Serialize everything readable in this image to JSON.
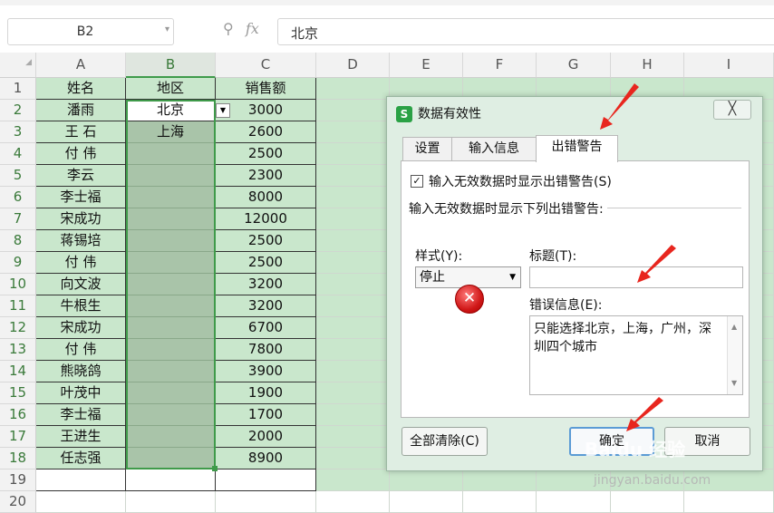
{
  "formula_bar": {
    "name_box": "B2",
    "value": "北京"
  },
  "columns": [
    "A",
    "B",
    "C",
    "D",
    "E",
    "F",
    "G",
    "H",
    "I"
  ],
  "rows": [
    {
      "n": "1",
      "a": "姓名",
      "b": "地区",
      "c": "销售额"
    },
    {
      "n": "2",
      "a": "潘雨",
      "b": "北京",
      "c": "3000"
    },
    {
      "n": "3",
      "a": "王  石",
      "b": "上海",
      "c": "2600"
    },
    {
      "n": "4",
      "a": "付  伟",
      "b": "",
      "c": "2500"
    },
    {
      "n": "5",
      "a": "李云",
      "b": "",
      "c": "2300"
    },
    {
      "n": "6",
      "a": "李士福",
      "b": "",
      "c": "8000"
    },
    {
      "n": "7",
      "a": "宋成功",
      "b": "",
      "c": "12000"
    },
    {
      "n": "8",
      "a": "蒋锡培",
      "b": "",
      "c": "2500"
    },
    {
      "n": "9",
      "a": "付  伟",
      "b": "",
      "c": "2500"
    },
    {
      "n": "10",
      "a": "向文波",
      "b": "",
      "c": "3200"
    },
    {
      "n": "11",
      "a": "牛根生",
      "b": "",
      "c": "3200"
    },
    {
      "n": "12",
      "a": "宋成功",
      "b": "",
      "c": "6700"
    },
    {
      "n": "13",
      "a": "付  伟",
      "b": "",
      "c": "7800"
    },
    {
      "n": "14",
      "a": "熊晓鸽",
      "b": "",
      "c": "3900"
    },
    {
      "n": "15",
      "a": "叶茂中",
      "b": "",
      "c": "1900"
    },
    {
      "n": "16",
      "a": "李士福",
      "b": "",
      "c": "1700"
    },
    {
      "n": "17",
      "a": "王进生",
      "b": "",
      "c": "2000"
    },
    {
      "n": "18",
      "a": "任志强",
      "b": "",
      "c": "8900"
    },
    {
      "n": "19",
      "a": "",
      "b": "",
      "c": ""
    },
    {
      "n": "20",
      "a": "",
      "b": "",
      "c": ""
    }
  ],
  "dialog": {
    "title": "数据有效性",
    "logo": "S",
    "close": "╳",
    "tabs": [
      "设置",
      "输入信息",
      "出错警告"
    ],
    "active_tab": "出错警告",
    "show_error_checkbox": "输入无效数据时显示出错警告(S)",
    "checked_mark": "✓",
    "group_label": "输入无效数据时显示下列出错警告:",
    "style_label": "样式(Y):",
    "style_value": "停止",
    "title_label": "标题(T):",
    "title_value": "",
    "error_label": "错误信息(E):",
    "error_message": "只能选择北京，上海，广州，深圳四个城市",
    "stop_glyph": "✕",
    "clear_all": "全部清除(C)",
    "ok": "确定",
    "cancel": "取消"
  },
  "watermark": {
    "brand": "Baidu 经验",
    "url": "jingyan.baidu.com"
  },
  "colors": {
    "accent_green": "#3f9a4a",
    "sheet_green": "#c9e7cc",
    "arrow_red": "#e8261e"
  }
}
